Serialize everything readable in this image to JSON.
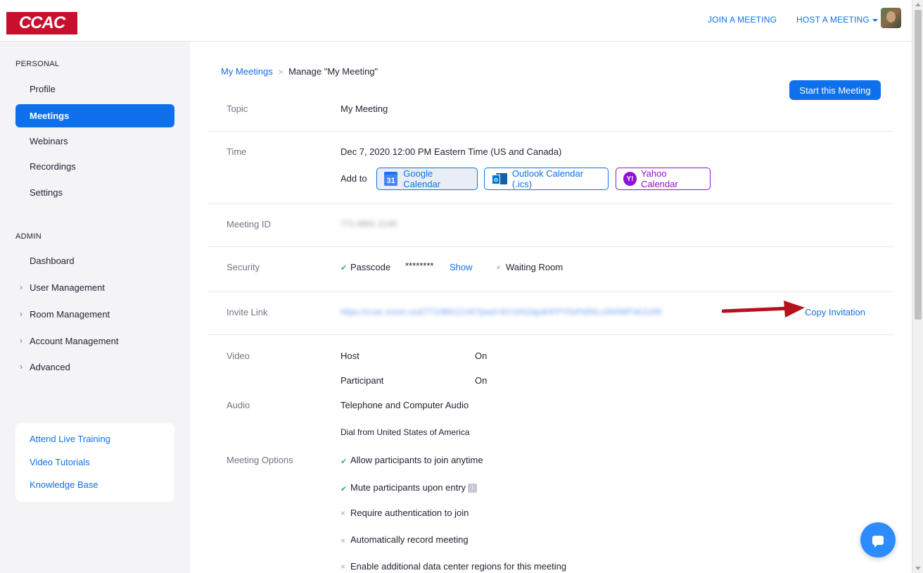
{
  "header": {
    "logo_text": "CCAC",
    "join_label": "JOIN A MEETING",
    "host_label": "HOST A MEETING"
  },
  "sidebar": {
    "personal_label": "PERSONAL",
    "personal_items": [
      "Profile",
      "Meetings",
      "Webinars",
      "Recordings",
      "Settings"
    ],
    "admin_label": "ADMIN",
    "admin_items": [
      "Dashboard",
      "User Management",
      "Room Management",
      "Account Management",
      "Advanced"
    ],
    "help_links": [
      "Attend Live Training",
      "Video Tutorials",
      "Knowledge Base"
    ]
  },
  "breadcrumb": {
    "parent": "My Meetings",
    "separator": ">",
    "current": "Manage \"My Meeting\""
  },
  "start_button": "Start this Meeting",
  "meeting": {
    "topic_label": "Topic",
    "topic": "My Meeting",
    "time_label": "Time",
    "time": "Dec 7, 2020 12:00 PM Eastern Time (US and Canada)",
    "add_to": "Add to",
    "google_cal": "Google Calendar",
    "google_icon_text": "31",
    "outlook_cal": "Outlook Calendar (.ics)",
    "outlook_icon_text": "o",
    "yahoo_cal": "Yahoo Calendar",
    "yahoo_icon_text": "Y!",
    "id_label": "Meeting ID",
    "id_value": "771 0891 2140",
    "security_label": "Security",
    "passcode_label": "Passcode",
    "passcode_value": "********",
    "show_label": "Show",
    "waiting_room_label": "Waiting Room",
    "invite_label": "Invite Link",
    "invite_url": "https://ccac.zoom.us/j/77108912140?pwd=bVJnN2dpdHFPY0xPd0hLc0h0WFhKZz09",
    "copy_invitation": "Copy Invitation",
    "video_label": "Video",
    "host_label": "Host",
    "host_value": "On",
    "participant_label": "Participant",
    "participant_value": "On",
    "audio_label": "Audio",
    "audio_value": "Telephone and Computer Audio",
    "dial_from": "Dial from United States of America",
    "options_label": "Meeting Options",
    "options": [
      {
        "text": "Allow participants to join anytime",
        "enabled": true
      },
      {
        "text": "Mute participants upon entry",
        "enabled": true
      },
      {
        "text": "Require authentication to join",
        "enabled": false
      },
      {
        "text": "Automatically record meeting",
        "enabled": false
      },
      {
        "text": "Enable additional data center regions for this meeting",
        "enabled": false
      }
    ]
  },
  "colors": {
    "brand_red": "#c8102e",
    "zoom_blue": "#0e71eb",
    "yahoo_purple": "#8f12d6",
    "arrow_red": "#b5121b"
  }
}
